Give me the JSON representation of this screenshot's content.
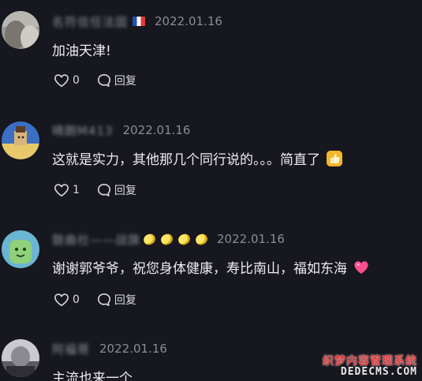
{
  "comments": [
    {
      "username": "名符信任法国",
      "date": "2022.01.16",
      "text": "加油天津!",
      "likes": "0",
      "reply_label": "回复"
    },
    {
      "username": "晴朗M413",
      "date": "2022.01.16",
      "text": "这就是实力，其他那几个同行说的。。。简直了",
      "likes": "1",
      "reply_label": "回复"
    },
    {
      "username": "鼓曲社——战旗",
      "date": "2022.01.16",
      "text": "谢谢郭爷爷，祝您身体健康，寿比南山，福如东海",
      "likes": "0",
      "reply_label": "回复"
    },
    {
      "username": "阿福哥",
      "date": "2022.01.16",
      "text": "主流也来一个",
      "likes": "",
      "reply_label": ""
    }
  ],
  "watermark": {
    "line1": "织梦内容管理系统",
    "line2": "DEDECMS.COM"
  },
  "colors": {
    "background": "#17171f",
    "text": "#ececf0",
    "meta": "#8c8c96"
  }
}
